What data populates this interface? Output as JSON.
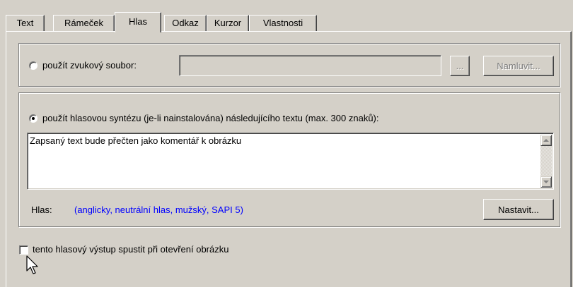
{
  "tabs": [
    {
      "label": "Text",
      "active": false
    },
    {
      "label": "Rámeček",
      "active": false
    },
    {
      "label": "Hlas",
      "active": true
    },
    {
      "label": "Odkaz",
      "active": false
    },
    {
      "label": "Kurzor",
      "active": false
    },
    {
      "label": "Vlastnosti",
      "active": false
    }
  ],
  "sound_file": {
    "label": "použít zvukový soubor:",
    "selected": false,
    "path_value": "",
    "browse_label": "...",
    "record_label": "Namluvit...",
    "record_enabled": false
  },
  "synthesis": {
    "label": "použít hlasovou syntézu (je-li nainstalována) následujícího textu (max. 300 znaků):",
    "selected": true,
    "text": "Zapsaný text bude přečten jako komentář k obrázku",
    "voice_label": "Hlas:",
    "voice_value": "(anglicky, neutrální hlas, mužský, SAPI 5)",
    "configure_label": "Nastavit..."
  },
  "autoplay": {
    "label": "tento hlasový výstup spustit při otevření obrázku",
    "checked": false
  },
  "colors": {
    "face": "#d4d0c8",
    "voice_value": "#0000ff",
    "disabled_text": "#808080"
  },
  "icons": [
    "mouse-pointer-icon",
    "scroll-up-arrow-icon",
    "scroll-down-arrow-icon"
  ]
}
